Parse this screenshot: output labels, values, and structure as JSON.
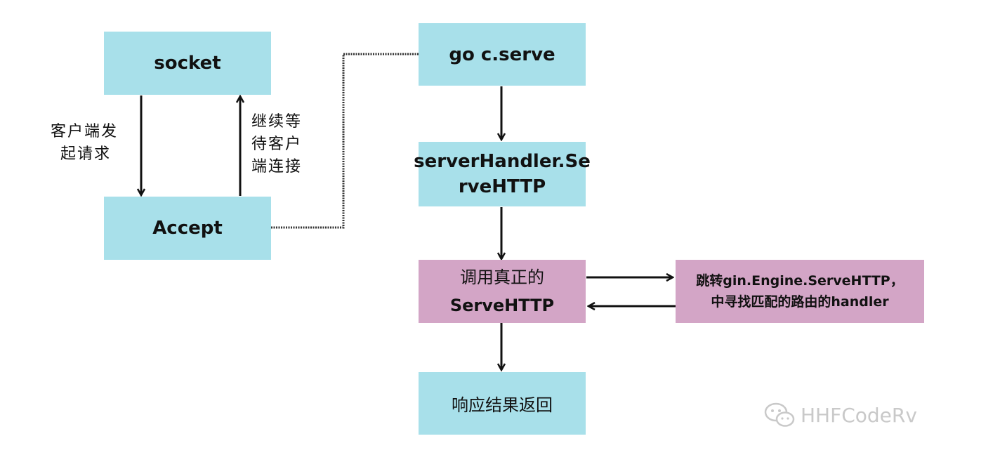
{
  "nodes": {
    "socket": "socket",
    "accept": "Accept",
    "go_serve": "go c.serve",
    "server_handler": [
      "serverHandler.Se",
      "rveHTTP"
    ],
    "real_serve": [
      "调用真正的",
      "ServeHTTP"
    ],
    "gin_engine": [
      "跳转gin.Engine.ServeHTTP，",
      "中寻找匹配的路由的handler"
    ],
    "response": "响应结果返回"
  },
  "edge_labels": {
    "client_request": [
      "客户端发",
      "起请求"
    ],
    "continue_wait": [
      "继续等",
      "待客户",
      "端连接"
    ]
  },
  "watermark": {
    "text": "HHFCodeRv",
    "icon": "wechat-icon"
  },
  "colors": {
    "blue": "#a8e0ea",
    "pink": "#d3a5c6"
  }
}
